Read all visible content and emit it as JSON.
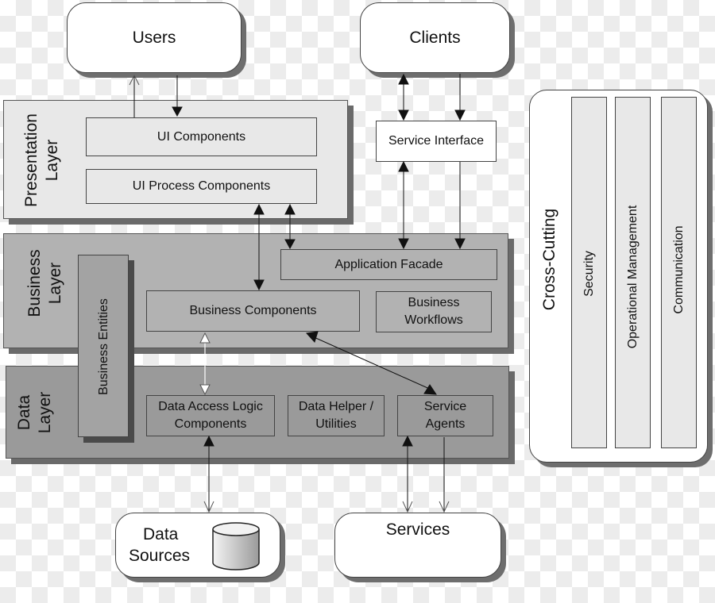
{
  "external": {
    "users": "Users",
    "clients": "Clients",
    "data_sources": [
      "Data",
      "Sources"
    ],
    "services": "Services"
  },
  "service_interface": "Service Interface",
  "presentation_layer": {
    "title": "Presentation Layer",
    "components": [
      "UI Components",
      "UI Process Components"
    ]
  },
  "business_layer": {
    "title": "Business Layer",
    "application_facade": "Application Facade",
    "business_components": "Business Components",
    "business_workflows": [
      "Business",
      "Workflows"
    ],
    "business_entities": "Business Entities"
  },
  "data_layer": {
    "title": "Data Layer",
    "data_access": [
      "Data Access Logic",
      "Components"
    ],
    "data_helper": [
      "Data Helper /",
      "Utilities"
    ],
    "service_agents": [
      "Service",
      "Agents"
    ]
  },
  "cross_cutting": {
    "title": "Cross-Cutting",
    "columns": [
      "Security",
      "Operational Management",
      "Communication"
    ]
  },
  "colors": {
    "presentation_fill": "#e8e8e8",
    "business_fill": "#b2b2b2",
    "data_fill": "#9a9a9a",
    "entities_fill": "#a3a3a3",
    "cross_column_fill": "#e8e8e8",
    "shadow": "#6a6a6a"
  }
}
